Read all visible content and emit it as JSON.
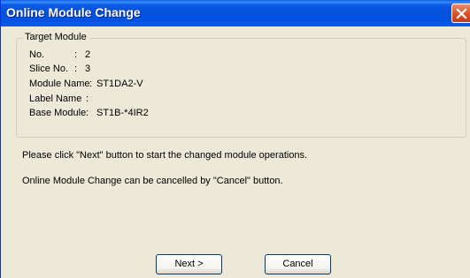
{
  "window": {
    "title": "Online Module Change"
  },
  "target_module": {
    "legend": "Target Module",
    "fields": [
      {
        "label": "No.",
        "separator": ":",
        "value": "2"
      },
      {
        "label": "Slice No.",
        "separator": ":",
        "value": "3"
      },
      {
        "label": "Module Name",
        "separator": ":",
        "value": "ST1DA2-V"
      },
      {
        "label": "Label Name",
        "separator": ":",
        "value": ""
      },
      {
        "label": "Base Module",
        "separator": ":",
        "value": "ST1B-*4IR2"
      }
    ]
  },
  "messages": {
    "instruction": "Please click \"Next\" button to start the changed module operations.",
    "cancel_note": "Online Module Change can be cancelled by \"Cancel\" button."
  },
  "buttons": {
    "next_label": "Next >",
    "cancel_label": "Cancel"
  },
  "icons": {
    "close": "close-icon"
  },
  "colors": {
    "titlebar": "#0451dc",
    "close_button": "#d9542b",
    "dialog_background": "#ece9d8"
  }
}
